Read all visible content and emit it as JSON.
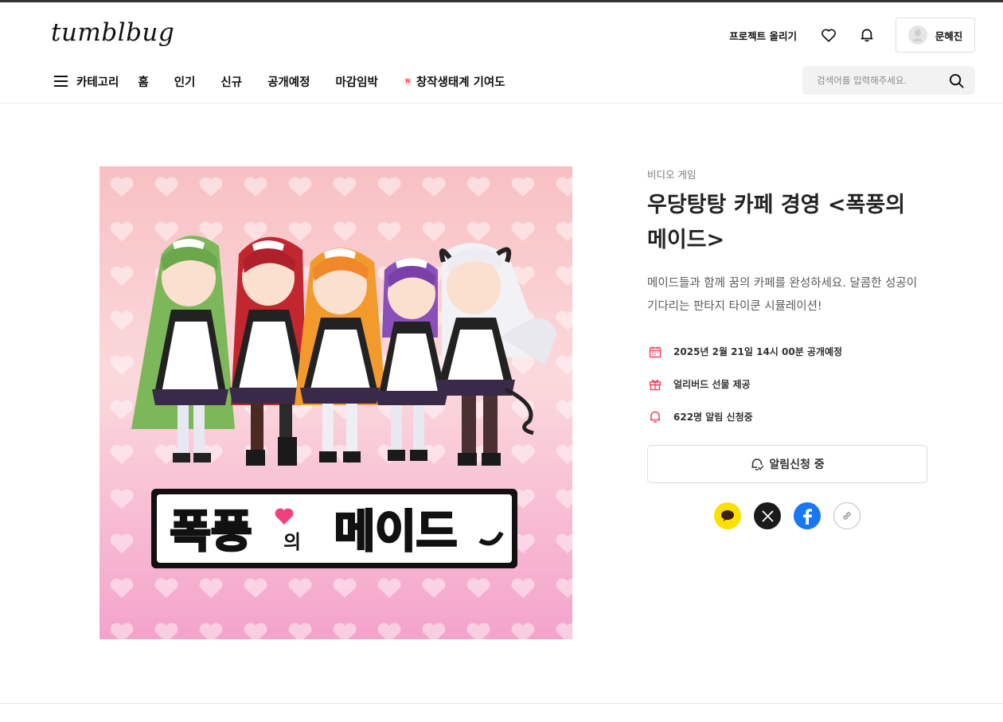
{
  "header": {
    "logo": "tumblbug",
    "upload_project": "프로젝트 올리기",
    "user_name": "문혜진",
    "icons": [
      "heart-icon",
      "bell-icon",
      "avatar-icon"
    ]
  },
  "nav": {
    "category": "카테고리",
    "items": [
      "홈",
      "인기",
      "신규",
      "공개예정",
      "마감임박"
    ],
    "contrib_badge": "N",
    "contrib": "창작생태계 기여도"
  },
  "search": {
    "placeholder": "검색어를 입력해주세요."
  },
  "project": {
    "category": "비디오 게임",
    "title_line1": "우당탕탕 카페 경영 <폭풍의",
    "title_line2": "메이드>",
    "desc_line1": "메이드들과 함께 꿈의 카페를 완성하세요. 달콤한 성공이",
    "desc_line2": "기다리는 판타지 타이쿤 시뮬레이션!",
    "cover_text_1": "폭풍",
    "cover_text_2": "의",
    "cover_text_3": "메이드",
    "meta": [
      {
        "icon": "calendar-icon",
        "text": "2025년 2월 21일 14시 00분 공개예정"
      },
      {
        "icon": "gift-icon",
        "text": "얼리버드 선물 제공"
      },
      {
        "icon": "bell-icon",
        "text": "622명 알림 신청중"
      }
    ],
    "notify_button": "알림신청 중"
  },
  "share": [
    "kakao-icon",
    "x-icon",
    "facebook-icon",
    "link-icon"
  ],
  "colors": {
    "accent": "#f0415a",
    "bg_pink_top": "#f9c4c6",
    "bg_pink_bottom": "#f6a7cc"
  }
}
